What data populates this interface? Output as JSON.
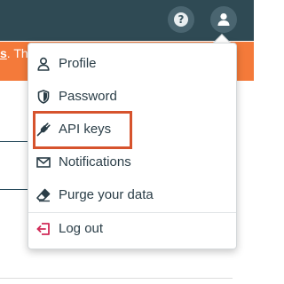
{
  "banner": {
    "link_text": "s",
    "rest_text": ". Th"
  },
  "header": {
    "help_glyph": "?",
    "help_icon": "question-circle-icon",
    "user_icon": "user-icon"
  },
  "menu": {
    "items": [
      {
        "label": "Profile",
        "icon": "user-outline-icon"
      },
      {
        "label": "Password",
        "icon": "shield-icon"
      },
      {
        "label": "API keys",
        "icon": "plug-icon"
      },
      {
        "label": "Notifications",
        "icon": "envelope-icon"
      },
      {
        "label": "Purge your data",
        "icon": "eraser-icon"
      },
      {
        "label": "Log out",
        "icon": "logout-icon"
      }
    ]
  },
  "colors": {
    "topbar": "#2f4a54",
    "banner": "#f47a3a",
    "highlight": "#d6532d",
    "logout_icon": "#d12a57"
  }
}
